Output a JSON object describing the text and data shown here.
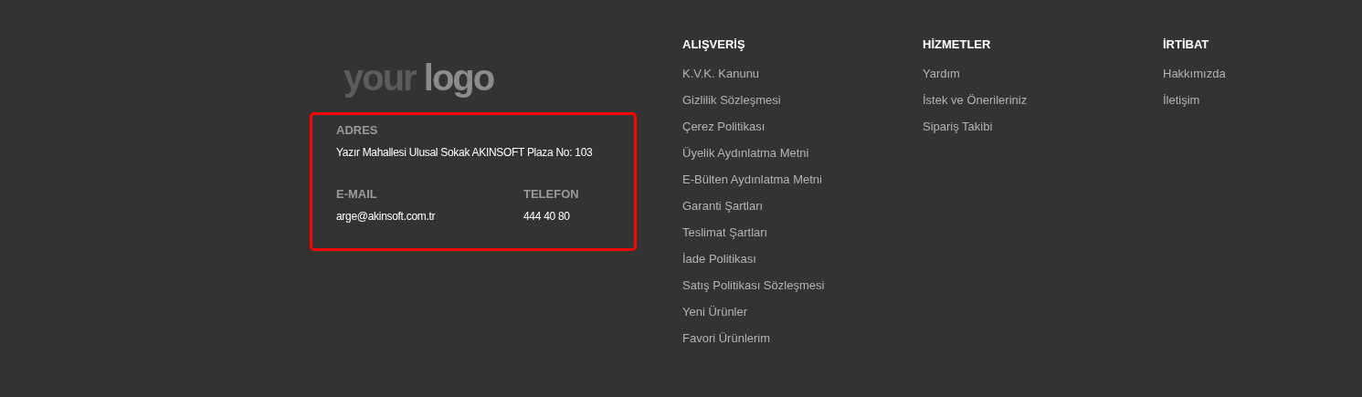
{
  "logo": {
    "words": [
      "your",
      "logo"
    ]
  },
  "contact": {
    "address_label": "ADRES",
    "address": "Yazır Mahallesi Ulusal Sokak AKINSOFT Plaza No: 103",
    "email_label": "E-MAIL",
    "email": "arge@akinsoft.com.tr",
    "phone_label": "TELEFON",
    "phone": "444 40 80"
  },
  "columns": [
    {
      "title": "ALIŞVERİŞ",
      "links": [
        "K.V.K. Kanunu",
        "Gizlilik Sözleşmesi",
        "Çerez Politikası",
        "Üyelik Aydınlatma Metni",
        "E-Bülten Aydınlatma Metni",
        "Garanti Şartları",
        "Teslimat Şartları",
        "İade Politikası",
        "Satış Politikası Sözleşmesi",
        "Yeni Ürünler",
        "Favori Ürünlerim"
      ]
    },
    {
      "title": "HİZMETLER",
      "links": [
        "Yardım",
        "İstek ve Önerileriniz",
        "Sipariş Takibi"
      ]
    },
    {
      "title": "İRTİBAT",
      "links": [
        "Hakkımızda",
        "İletişim"
      ]
    }
  ]
}
